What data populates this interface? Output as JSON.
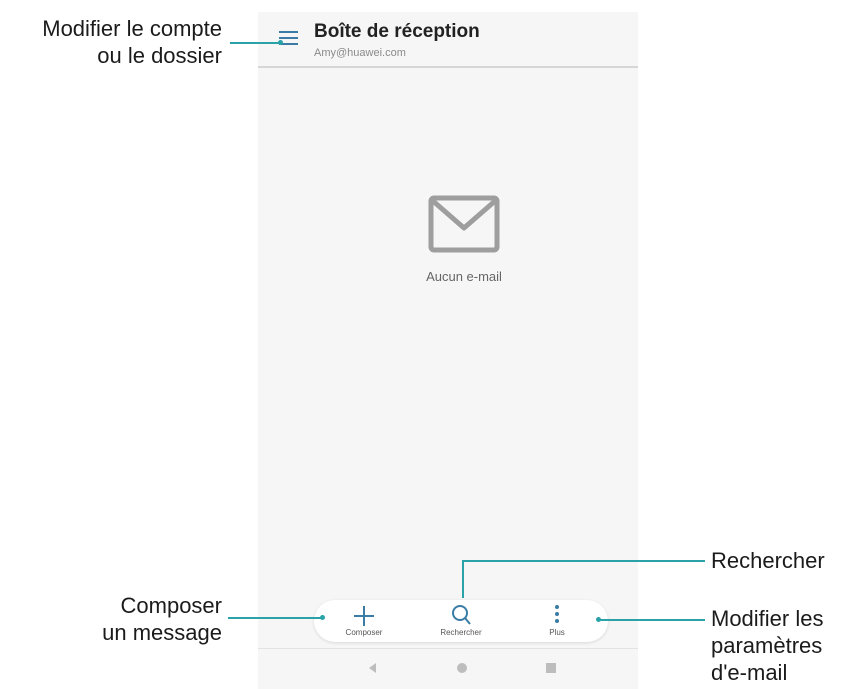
{
  "header": {
    "title": "Boîte de réception",
    "subtitle": "Amy@huawei.com"
  },
  "empty_state": {
    "icon": "envelope-icon",
    "text": "Aucun e-mail"
  },
  "bottom_bar": {
    "compose_label": "Composer",
    "search_label": "Rechercher",
    "more_label": "Plus"
  },
  "nav_bar": [
    "back-icon",
    "home-icon",
    "recents-icon"
  ],
  "callouts": {
    "account": [
      "Modifier le compte",
      "ou le dossier"
    ],
    "compose": [
      "Composer",
      "un message"
    ],
    "search": "Rechercher",
    "settings": [
      "Modifier les",
      "paramètres",
      "d'e-mail"
    ]
  },
  "colors": {
    "accent": "#3a7ca5",
    "callout_line": "#2aa3a8",
    "icon_gray": "#9e9e9e"
  }
}
